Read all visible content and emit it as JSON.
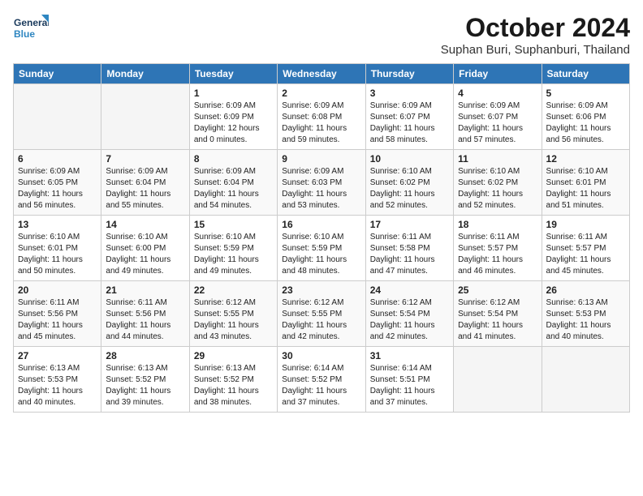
{
  "header": {
    "logo_line1": "General",
    "logo_line2": "Blue",
    "month": "October 2024",
    "location": "Suphan Buri, Suphanburi, Thailand"
  },
  "weekdays": [
    "Sunday",
    "Monday",
    "Tuesday",
    "Wednesday",
    "Thursday",
    "Friday",
    "Saturday"
  ],
  "weeks": [
    [
      {
        "day": "",
        "empty": true
      },
      {
        "day": "",
        "empty": true
      },
      {
        "day": "1",
        "sunrise": "Sunrise: 6:09 AM",
        "sunset": "Sunset: 6:09 PM",
        "daylight": "Daylight: 12 hours and 0 minutes."
      },
      {
        "day": "2",
        "sunrise": "Sunrise: 6:09 AM",
        "sunset": "Sunset: 6:08 PM",
        "daylight": "Daylight: 11 hours and 59 minutes."
      },
      {
        "day": "3",
        "sunrise": "Sunrise: 6:09 AM",
        "sunset": "Sunset: 6:07 PM",
        "daylight": "Daylight: 11 hours and 58 minutes."
      },
      {
        "day": "4",
        "sunrise": "Sunrise: 6:09 AM",
        "sunset": "Sunset: 6:07 PM",
        "daylight": "Daylight: 11 hours and 57 minutes."
      },
      {
        "day": "5",
        "sunrise": "Sunrise: 6:09 AM",
        "sunset": "Sunset: 6:06 PM",
        "daylight": "Daylight: 11 hours and 56 minutes."
      }
    ],
    [
      {
        "day": "6",
        "sunrise": "Sunrise: 6:09 AM",
        "sunset": "Sunset: 6:05 PM",
        "daylight": "Daylight: 11 hours and 56 minutes."
      },
      {
        "day": "7",
        "sunrise": "Sunrise: 6:09 AM",
        "sunset": "Sunset: 6:04 PM",
        "daylight": "Daylight: 11 hours and 55 minutes."
      },
      {
        "day": "8",
        "sunrise": "Sunrise: 6:09 AM",
        "sunset": "Sunset: 6:04 PM",
        "daylight": "Daylight: 11 hours and 54 minutes."
      },
      {
        "day": "9",
        "sunrise": "Sunrise: 6:09 AM",
        "sunset": "Sunset: 6:03 PM",
        "daylight": "Daylight: 11 hours and 53 minutes."
      },
      {
        "day": "10",
        "sunrise": "Sunrise: 6:10 AM",
        "sunset": "Sunset: 6:02 PM",
        "daylight": "Daylight: 11 hours and 52 minutes."
      },
      {
        "day": "11",
        "sunrise": "Sunrise: 6:10 AM",
        "sunset": "Sunset: 6:02 PM",
        "daylight": "Daylight: 11 hours and 52 minutes."
      },
      {
        "day": "12",
        "sunrise": "Sunrise: 6:10 AM",
        "sunset": "Sunset: 6:01 PM",
        "daylight": "Daylight: 11 hours and 51 minutes."
      }
    ],
    [
      {
        "day": "13",
        "sunrise": "Sunrise: 6:10 AM",
        "sunset": "Sunset: 6:01 PM",
        "daylight": "Daylight: 11 hours and 50 minutes."
      },
      {
        "day": "14",
        "sunrise": "Sunrise: 6:10 AM",
        "sunset": "Sunset: 6:00 PM",
        "daylight": "Daylight: 11 hours and 49 minutes."
      },
      {
        "day": "15",
        "sunrise": "Sunrise: 6:10 AM",
        "sunset": "Sunset: 5:59 PM",
        "daylight": "Daylight: 11 hours and 49 minutes."
      },
      {
        "day": "16",
        "sunrise": "Sunrise: 6:10 AM",
        "sunset": "Sunset: 5:59 PM",
        "daylight": "Daylight: 11 hours and 48 minutes."
      },
      {
        "day": "17",
        "sunrise": "Sunrise: 6:11 AM",
        "sunset": "Sunset: 5:58 PM",
        "daylight": "Daylight: 11 hours and 47 minutes."
      },
      {
        "day": "18",
        "sunrise": "Sunrise: 6:11 AM",
        "sunset": "Sunset: 5:57 PM",
        "daylight": "Daylight: 11 hours and 46 minutes."
      },
      {
        "day": "19",
        "sunrise": "Sunrise: 6:11 AM",
        "sunset": "Sunset: 5:57 PM",
        "daylight": "Daylight: 11 hours and 45 minutes."
      }
    ],
    [
      {
        "day": "20",
        "sunrise": "Sunrise: 6:11 AM",
        "sunset": "Sunset: 5:56 PM",
        "daylight": "Daylight: 11 hours and 45 minutes."
      },
      {
        "day": "21",
        "sunrise": "Sunrise: 6:11 AM",
        "sunset": "Sunset: 5:56 PM",
        "daylight": "Daylight: 11 hours and 44 minutes."
      },
      {
        "day": "22",
        "sunrise": "Sunrise: 6:12 AM",
        "sunset": "Sunset: 5:55 PM",
        "daylight": "Daylight: 11 hours and 43 minutes."
      },
      {
        "day": "23",
        "sunrise": "Sunrise: 6:12 AM",
        "sunset": "Sunset: 5:55 PM",
        "daylight": "Daylight: 11 hours and 42 minutes."
      },
      {
        "day": "24",
        "sunrise": "Sunrise: 6:12 AM",
        "sunset": "Sunset: 5:54 PM",
        "daylight": "Daylight: 11 hours and 42 minutes."
      },
      {
        "day": "25",
        "sunrise": "Sunrise: 6:12 AM",
        "sunset": "Sunset: 5:54 PM",
        "daylight": "Daylight: 11 hours and 41 minutes."
      },
      {
        "day": "26",
        "sunrise": "Sunrise: 6:13 AM",
        "sunset": "Sunset: 5:53 PM",
        "daylight": "Daylight: 11 hours and 40 minutes."
      }
    ],
    [
      {
        "day": "27",
        "sunrise": "Sunrise: 6:13 AM",
        "sunset": "Sunset: 5:53 PM",
        "daylight": "Daylight: 11 hours and 40 minutes."
      },
      {
        "day": "28",
        "sunrise": "Sunrise: 6:13 AM",
        "sunset": "Sunset: 5:52 PM",
        "daylight": "Daylight: 11 hours and 39 minutes."
      },
      {
        "day": "29",
        "sunrise": "Sunrise: 6:13 AM",
        "sunset": "Sunset: 5:52 PM",
        "daylight": "Daylight: 11 hours and 38 minutes."
      },
      {
        "day": "30",
        "sunrise": "Sunrise: 6:14 AM",
        "sunset": "Sunset: 5:52 PM",
        "daylight": "Daylight: 11 hours and 37 minutes."
      },
      {
        "day": "31",
        "sunrise": "Sunrise: 6:14 AM",
        "sunset": "Sunset: 5:51 PM",
        "daylight": "Daylight: 11 hours and 37 minutes."
      },
      {
        "day": "",
        "empty": true
      },
      {
        "day": "",
        "empty": true
      }
    ]
  ]
}
